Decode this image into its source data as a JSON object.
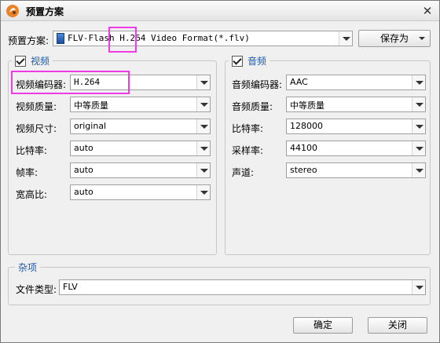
{
  "window": {
    "title": "预置方案",
    "close_symbol": "✕"
  },
  "preset": {
    "label": "预置方案:",
    "value_prefix": "FLV-Flash ",
    "value_codec": "H.264",
    "value_suffix": " Video Format(*.flv)",
    "save_as_label": "保存为"
  },
  "video": {
    "group_title": "视频",
    "checked": true,
    "rows": [
      {
        "label": "视频编码器:",
        "value": "H.264"
      },
      {
        "label": "视频质量:",
        "value": "中等质量"
      },
      {
        "label": "视频尺寸:",
        "value": "original"
      },
      {
        "label": "比特率:",
        "value": "auto"
      },
      {
        "label": "帧率:",
        "value": "auto"
      },
      {
        "label": "宽高比:",
        "value": "auto"
      }
    ]
  },
  "audio": {
    "group_title": "音频",
    "checked": true,
    "rows": [
      {
        "label": "音频编码器:",
        "value": "AAC"
      },
      {
        "label": "音频质量:",
        "value": "中等质量"
      },
      {
        "label": "比特率:",
        "value": "128000"
      },
      {
        "label": "采样率:",
        "value": "44100"
      },
      {
        "label": "声道:",
        "value": "stereo"
      }
    ]
  },
  "misc": {
    "group_title": "杂项",
    "file_type_label": "文件类型:",
    "file_type_value": "FLV"
  },
  "buttons": {
    "ok": "确定",
    "close": "关闭"
  },
  "colors": {
    "highlight": "#ee3be6",
    "group_title": "#1e5aa8"
  }
}
